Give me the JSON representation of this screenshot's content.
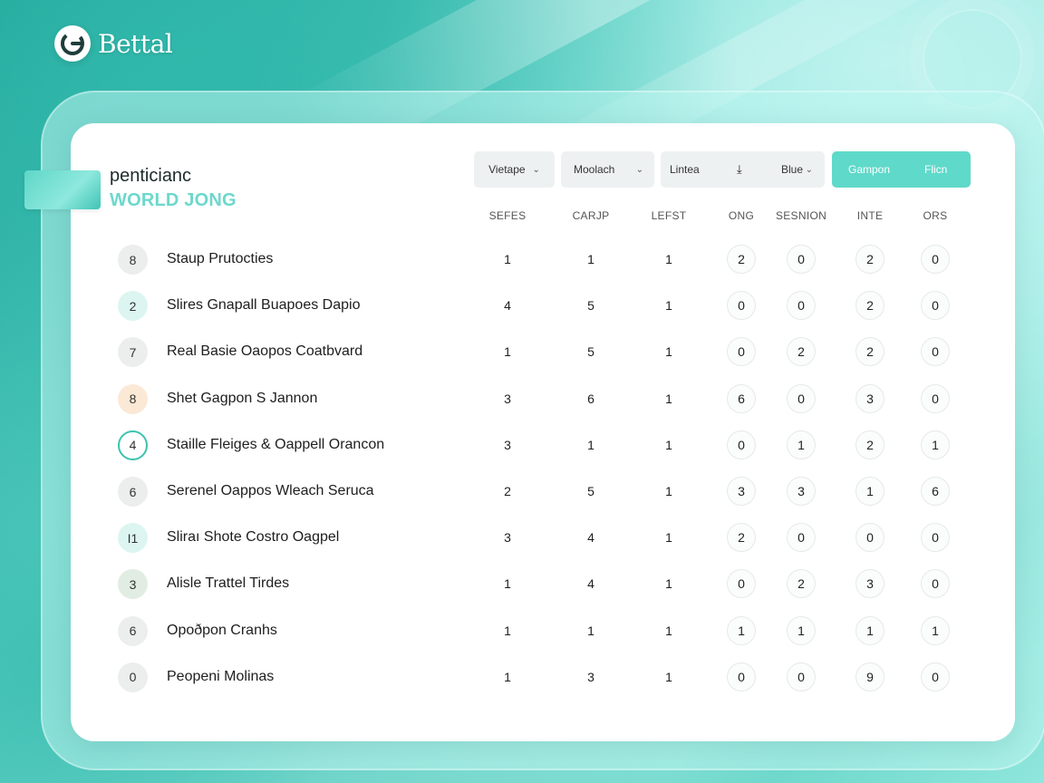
{
  "brand": {
    "name": "Bettal"
  },
  "header": {
    "title_line1": "penticianc",
    "title_line2": "WORLD JONG"
  },
  "filters": {
    "f1_label": "Vietape",
    "f2_label": "Moolach",
    "f3_label": "Lintea",
    "f3_value": "Blue",
    "toggle_on": "Gampon",
    "toggle_off": "Flicn"
  },
  "columns": [
    "SEFES",
    "CARJP",
    "LEFST",
    "ONG",
    "SESNION",
    "INTE",
    "ORS"
  ],
  "rows": [
    {
      "rank": "8",
      "name": "Staup Prutocties",
      "cells": [
        "1",
        "1",
        "1",
        "2",
        "0",
        "2",
        "0"
      ]
    },
    {
      "rank": "2",
      "name": "Slires Gnapall Buapoes Dapio",
      "cells": [
        "4",
        "5",
        "1",
        "0",
        "0",
        "2",
        "0"
      ]
    },
    {
      "rank": "7",
      "name": "Real Basie Oaopos Coatbvard",
      "cells": [
        "1",
        "5",
        "1",
        "0",
        "2",
        "2",
        "0"
      ]
    },
    {
      "rank": "8",
      "name": "Shet Gagpon S Jannon",
      "cells": [
        "3",
        "6",
        "1",
        "6",
        "0",
        "3",
        "0"
      ]
    },
    {
      "rank": "4",
      "name": "Staille Fleiges & Oappell Orancon",
      "cells": [
        "3",
        "1",
        "1",
        "0",
        "1",
        "2",
        "1"
      ]
    },
    {
      "rank": "6",
      "name": "Serenel Oappos Wleach Seruca",
      "cells": [
        "2",
        "5",
        "1",
        "3",
        "3",
        "1",
        "6"
      ]
    },
    {
      "rank": "I1",
      "name": "Sliraı Shote Costro Oagpel",
      "cells": [
        "3",
        "4",
        "1",
        "2",
        "0",
        "0",
        "0"
      ]
    },
    {
      "rank": "3",
      "name": "Alisle Trattel Tirdes",
      "cells": [
        "1",
        "4",
        "1",
        "0",
        "2",
        "3",
        "0"
      ]
    },
    {
      "rank": "6",
      "name": "Opoðpon Cranhs",
      "cells": [
        "1",
        "1",
        "1",
        "1",
        "1",
        "1",
        "1"
      ]
    },
    {
      "rank": "0",
      "name": "Peopeni Molinas",
      "cells": [
        "1",
        "3",
        "1",
        "0",
        "0",
        "9",
        "0"
      ]
    }
  ],
  "colors": {
    "accent": "#5fd9c9",
    "title_accent": "#6dd8cc",
    "active_ring": "#3cc3b0"
  }
}
